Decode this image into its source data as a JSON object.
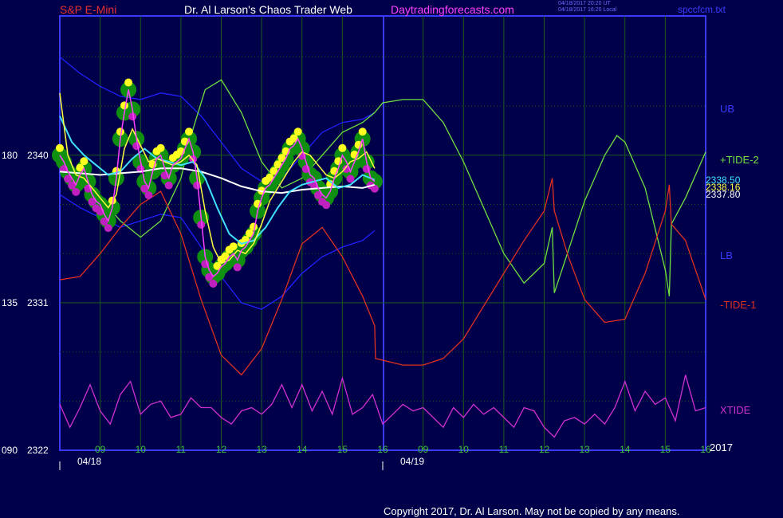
{
  "header": {
    "left": "S&P E-Mini",
    "center": "Dr. Al Larson's Chaos Trader Web",
    "right": "Daytradingforecasts.com",
    "stamp1": "04/18/2017 20:20 UT",
    "stamp2": "04/18/2017 16:20 Local",
    "file": "spccfcm.txt"
  },
  "footer": {
    "copyright": "Copyright 2017, Dr. Al Larson. May not be copied by any means."
  },
  "colors": {
    "background": "#00004a",
    "frame": "#3a3aff",
    "grid": "#1a5a1a",
    "price": "#ff40ff",
    "fast_avg": "#ffff40",
    "mid_avg": "#40e0ff",
    "slow_avg": "#ffffff",
    "band": "#2020ff",
    "tide2": "#70e040",
    "tide1": "#e03020",
    "xtide": "#d030d0",
    "bubble_green": "#109010",
    "dot_yellow": "#ffff20",
    "dot_magenta": "#c020c0"
  },
  "chart_data": {
    "type": "line",
    "title": "S&P E-Mini",
    "y_axis": {
      "ticks": [
        {
          "left": "180",
          "right": "2340",
          "value": 2340
        },
        {
          "left": "135",
          "right": "2331",
          "value": 2331
        },
        {
          "left": "090",
          "right": "2322",
          "value": 2322
        }
      ],
      "ylim": [
        2322,
        2348.5
      ]
    },
    "x_axis": {
      "hour_ticks": [
        "09",
        "10",
        "11",
        "12",
        "13",
        "14",
        "15",
        "16",
        "09",
        "10",
        "11",
        "12",
        "13",
        "14",
        "15",
        "16"
      ],
      "date_labels": [
        {
          "label": "04/18",
          "at": 0
        },
        {
          "label": "04/19",
          "at": 8
        }
      ],
      "year_label": "2017",
      "xlim": [
        0,
        16
      ]
    },
    "last_values": {
      "v1": "2338.50",
      "v2": "2338.16",
      "v3": "2337.80"
    },
    "series_labels": {
      "ub": "UB",
      "tide2": "+TIDE-2",
      "lb": "LB",
      "tide1": "-TIDE-1",
      "xtide": "XTIDE"
    },
    "series": {
      "price": {
        "x": [
          0,
          0.1,
          0.2,
          0.3,
          0.4,
          0.5,
          0.6,
          0.7,
          0.8,
          0.9,
          1.0,
          1.1,
          1.2,
          1.3,
          1.4,
          1.5,
          1.6,
          1.7,
          1.8,
          1.9,
          2.0,
          2.1,
          2.2,
          2.3,
          2.4,
          2.5,
          2.6,
          2.7,
          2.8,
          2.9,
          3.0,
          3.1,
          3.2,
          3.3,
          3.4,
          3.5,
          3.6,
          3.7,
          3.8,
          3.9,
          4.0,
          4.1,
          4.2,
          4.3,
          4.4,
          4.5,
          4.6,
          4.7,
          4.8,
          4.9,
          5.0,
          5.1,
          5.2,
          5.3,
          5.4,
          5.5,
          5.6,
          5.7,
          5.8,
          5.9,
          6.0,
          6.1,
          6.2,
          6.3,
          6.4,
          6.5,
          6.6,
          6.7,
          6.8,
          6.9,
          7.0,
          7.1,
          7.2,
          7.3,
          7.4,
          7.5,
          7.6,
          7.7,
          7.8
        ],
        "y": [
          2340.0,
          2339.6,
          2339.0,
          2338.6,
          2338.2,
          2338.8,
          2339.2,
          2338.4,
          2337.6,
          2337.2,
          2337.0,
          2336.4,
          2336.0,
          2336.8,
          2338.6,
          2341.0,
          2342.6,
          2344.0,
          2342.8,
          2341.0,
          2339.6,
          2338.4,
          2338.0,
          2339.0,
          2339.8,
          2340.0,
          2339.2,
          2338.6,
          2339.4,
          2339.6,
          2339.8,
          2340.4,
          2341.0,
          2340.2,
          2338.6,
          2336.2,
          2333.8,
          2333.0,
          2332.6,
          2332.8,
          2333.2,
          2333.4,
          2333.8,
          2334.0,
          2333.6,
          2334.2,
          2334.4,
          2334.8,
          2335.2,
          2336.6,
          2337.4,
          2338.0,
          2338.2,
          2338.6,
          2339.0,
          2339.4,
          2339.8,
          2340.4,
          2340.6,
          2341.0,
          2340.4,
          2339.6,
          2338.8,
          2338.6,
          2338.0,
          2337.6,
          2337.4,
          2337.8,
          2338.6,
          2339.2,
          2340.0,
          2339.6,
          2339.0,
          2339.6,
          2340.2,
          2341.0,
          2339.6,
          2338.6,
          2338.4
        ]
      },
      "fast_avg": {
        "x": [
          0,
          0.2,
          0.4,
          0.6,
          0.8,
          1.0,
          1.2,
          1.4,
          1.6,
          1.8,
          2.0,
          2.2,
          2.4,
          2.6,
          2.8,
          3.0,
          3.2,
          3.4,
          3.6,
          3.8,
          4.0,
          4.2,
          4.4,
          4.6,
          4.8,
          5.0,
          5.2,
          5.4,
          5.6,
          5.8,
          6.0,
          6.2,
          6.4,
          6.6,
          6.8,
          7.0,
          7.2,
          7.4,
          7.6,
          7.8
        ],
        "y": [
          2343.8,
          2340.0,
          2338.8,
          2338.6,
          2338.0,
          2337.4,
          2336.8,
          2337.6,
          2340.4,
          2341.6,
          2340.6,
          2339.6,
          2339.8,
          2339.6,
          2339.4,
          2339.6,
          2340.0,
          2339.4,
          2336.6,
          2334.4,
          2333.4,
          2333.6,
          2334.2,
          2334.0,
          2334.6,
          2335.8,
          2337.2,
          2338.0,
          2338.8,
          2339.6,
          2340.2,
          2340.0,
          2339.4,
          2338.8,
          2338.6,
          2339.0,
          2339.6,
          2339.8,
          2340.2,
          2339.2
        ]
      },
      "mid_avg": {
        "x": [
          0,
          0.3,
          0.6,
          0.9,
          1.2,
          1.5,
          1.8,
          2.1,
          2.4,
          2.7,
          3.0,
          3.3,
          3.6,
          3.9,
          4.2,
          4.5,
          4.8,
          5.1,
          5.4,
          5.7,
          6.0,
          6.3,
          6.6,
          6.9,
          7.2,
          7.5,
          7.8
        ],
        "y": [
          2342.4,
          2340.8,
          2340.0,
          2339.4,
          2338.8,
          2339.0,
          2339.8,
          2340.4,
          2339.8,
          2339.6,
          2339.4,
          2339.6,
          2338.6,
          2336.8,
          2335.2,
          2334.6,
          2334.8,
          2335.6,
          2336.8,
          2337.8,
          2338.2,
          2338.4,
          2338.6,
          2338.0,
          2338.2,
          2338.8,
          2338.5
        ]
      },
      "slow_avg": {
        "x": [
          0,
          0.5,
          1.0,
          1.5,
          2.0,
          2.5,
          3.0,
          3.5,
          4.0,
          4.5,
          5.0,
          5.5,
          6.0,
          6.5,
          7.0,
          7.5,
          7.8
        ],
        "y": [
          2339.0,
          2338.9,
          2338.8,
          2338.9,
          2339.0,
          2339.2,
          2339.2,
          2339.0,
          2338.6,
          2338.1,
          2337.8,
          2337.7,
          2337.9,
          2338.0,
          2338.1,
          2338.0,
          2338.2
        ]
      },
      "upper_band": {
        "x": [
          0,
          0.5,
          1.0,
          1.5,
          2.0,
          2.5,
          3.0,
          3.5,
          4.0,
          4.5,
          5.0,
          5.5,
          6.0,
          6.5,
          7.0,
          7.5,
          7.8
        ],
        "y": [
          2346.0,
          2345.0,
          2344.2,
          2343.6,
          2343.4,
          2343.8,
          2343.6,
          2342.4,
          2340.8,
          2339.2,
          2338.4,
          2338.6,
          2340.0,
          2341.4,
          2342.0,
          2342.2,
          2342.6
        ]
      },
      "lower_band": {
        "x": [
          0,
          0.5,
          1.0,
          1.5,
          2.0,
          2.5,
          3.0,
          3.5,
          4.0,
          4.5,
          5.0,
          5.5,
          6.0,
          6.5,
          7.0,
          7.5,
          7.8
        ],
        "y": [
          2337.6,
          2336.8,
          2336.2,
          2335.6,
          2336.0,
          2336.4,
          2336.2,
          2334.4,
          2332.6,
          2331.0,
          2330.6,
          2331.4,
          2332.8,
          2333.8,
          2334.4,
          2334.8,
          2335.4
        ]
      },
      "tide2": {
        "x": [
          0,
          0.5,
          1.0,
          1.5,
          2.0,
          2.5,
          3.0,
          3.3,
          3.6,
          4.0,
          4.5,
          5.0,
          5.5,
          6.0,
          6.5,
          7.0,
          7.5,
          7.8,
          8.0,
          8.5,
          9.0,
          9.5,
          10.0,
          10.5,
          11.0,
          11.5,
          12.0,
          12.2,
          12.25,
          12.6,
          13.0,
          13.5,
          13.8,
          14.0,
          14.5,
          15.0,
          15.1,
          15.15,
          15.5,
          16.0
        ],
        "y": [
          2340.2,
          2338.8,
          2337.4,
          2336.0,
          2335.0,
          2336.0,
          2338.6,
          2341.6,
          2344.0,
          2344.6,
          2342.6,
          2339.6,
          2338.0,
          2338.6,
          2340.0,
          2341.4,
          2342.0,
          2342.6,
          2343.2,
          2343.4,
          2343.4,
          2342.0,
          2339.6,
          2336.8,
          2334.0,
          2332.2,
          2333.4,
          2335.6,
          2331.6,
          2334.2,
          2337.2,
          2340.0,
          2341.2,
          2340.8,
          2338.0,
          2333.0,
          2331.4,
          2335.8,
          2337.4,
          2340.2
        ]
      },
      "tide1": {
        "x": [
          0,
          0.5,
          1.0,
          1.5,
          2.0,
          2.5,
          3.0,
          3.5,
          4.0,
          4.5,
          5.0,
          5.5,
          6.0,
          6.5,
          7.0,
          7.5,
          7.8,
          7.82,
          8.5,
          9.0,
          9.5,
          10.0,
          10.5,
          11.0,
          11.5,
          12.0,
          12.2,
          12.25,
          12.6,
          13.0,
          13.5,
          14.0,
          14.5,
          15.0,
          15.1,
          15.15,
          15.5,
          16.0
        ],
        "y": [
          2332.4,
          2332.6,
          2334.0,
          2335.6,
          2337.0,
          2337.8,
          2335.2,
          2331.2,
          2327.8,
          2326.6,
          2328.2,
          2331.2,
          2334.6,
          2335.6,
          2333.8,
          2331.4,
          2329.6,
          2327.6,
          2327.2,
          2327.2,
          2327.6,
          2328.8,
          2330.8,
          2332.8,
          2334.8,
          2336.6,
          2338.6,
          2336.6,
          2333.8,
          2331.2,
          2329.8,
          2330.0,
          2332.8,
          2336.6,
          2338.2,
          2335.8,
          2334.8,
          2331.2
        ]
      },
      "xtide": {
        "x": [
          0,
          0.25,
          0.5,
          0.75,
          1.0,
          1.25,
          1.5,
          1.75,
          2.0,
          2.25,
          2.5,
          2.75,
          3.0,
          3.25,
          3.5,
          3.75,
          4.0,
          4.25,
          4.5,
          4.75,
          5.0,
          5.25,
          5.5,
          5.75,
          6.0,
          6.25,
          6.5,
          6.75,
          7.0,
          7.25,
          7.5,
          7.75,
          8.0,
          8.25,
          8.5,
          8.75,
          9.0,
          9.25,
          9.5,
          9.75,
          10.0,
          10.25,
          10.5,
          10.75,
          11.0,
          11.25,
          11.5,
          11.75,
          12.0,
          12.25,
          12.5,
          12.75,
          13.0,
          13.25,
          13.5,
          13.75,
          14.0,
          14.25,
          14.5,
          14.75,
          15.0,
          15.25,
          15.5,
          15.75,
          16.0
        ],
        "y": [
          2324.8,
          2323.4,
          2324.6,
          2326.0,
          2324.4,
          2323.6,
          2325.4,
          2326.2,
          2324.2,
          2324.8,
          2325.0,
          2324.0,
          2324.2,
          2325.2,
          2324.6,
          2324.6,
          2324.0,
          2323.6,
          2324.4,
          2324.6,
          2324.2,
          2324.8,
          2326.0,
          2324.6,
          2326.0,
          2324.4,
          2325.6,
          2324.2,
          2326.4,
          2324.2,
          2324.6,
          2325.4,
          2323.6,
          2324.2,
          2324.8,
          2324.4,
          2324.6,
          2324.0,
          2323.4,
          2324.6,
          2324.0,
          2324.8,
          2324.2,
          2324.6,
          2324.0,
          2323.4,
          2324.6,
          2324.4,
          2323.4,
          2322.8,
          2323.8,
          2324.0,
          2323.6,
          2324.2,
          2323.6,
          2324.6,
          2326.2,
          2324.4,
          2325.6,
          2324.8,
          2325.2,
          2323.8,
          2326.6,
          2324.4,
          2324.6
        ]
      }
    }
  }
}
